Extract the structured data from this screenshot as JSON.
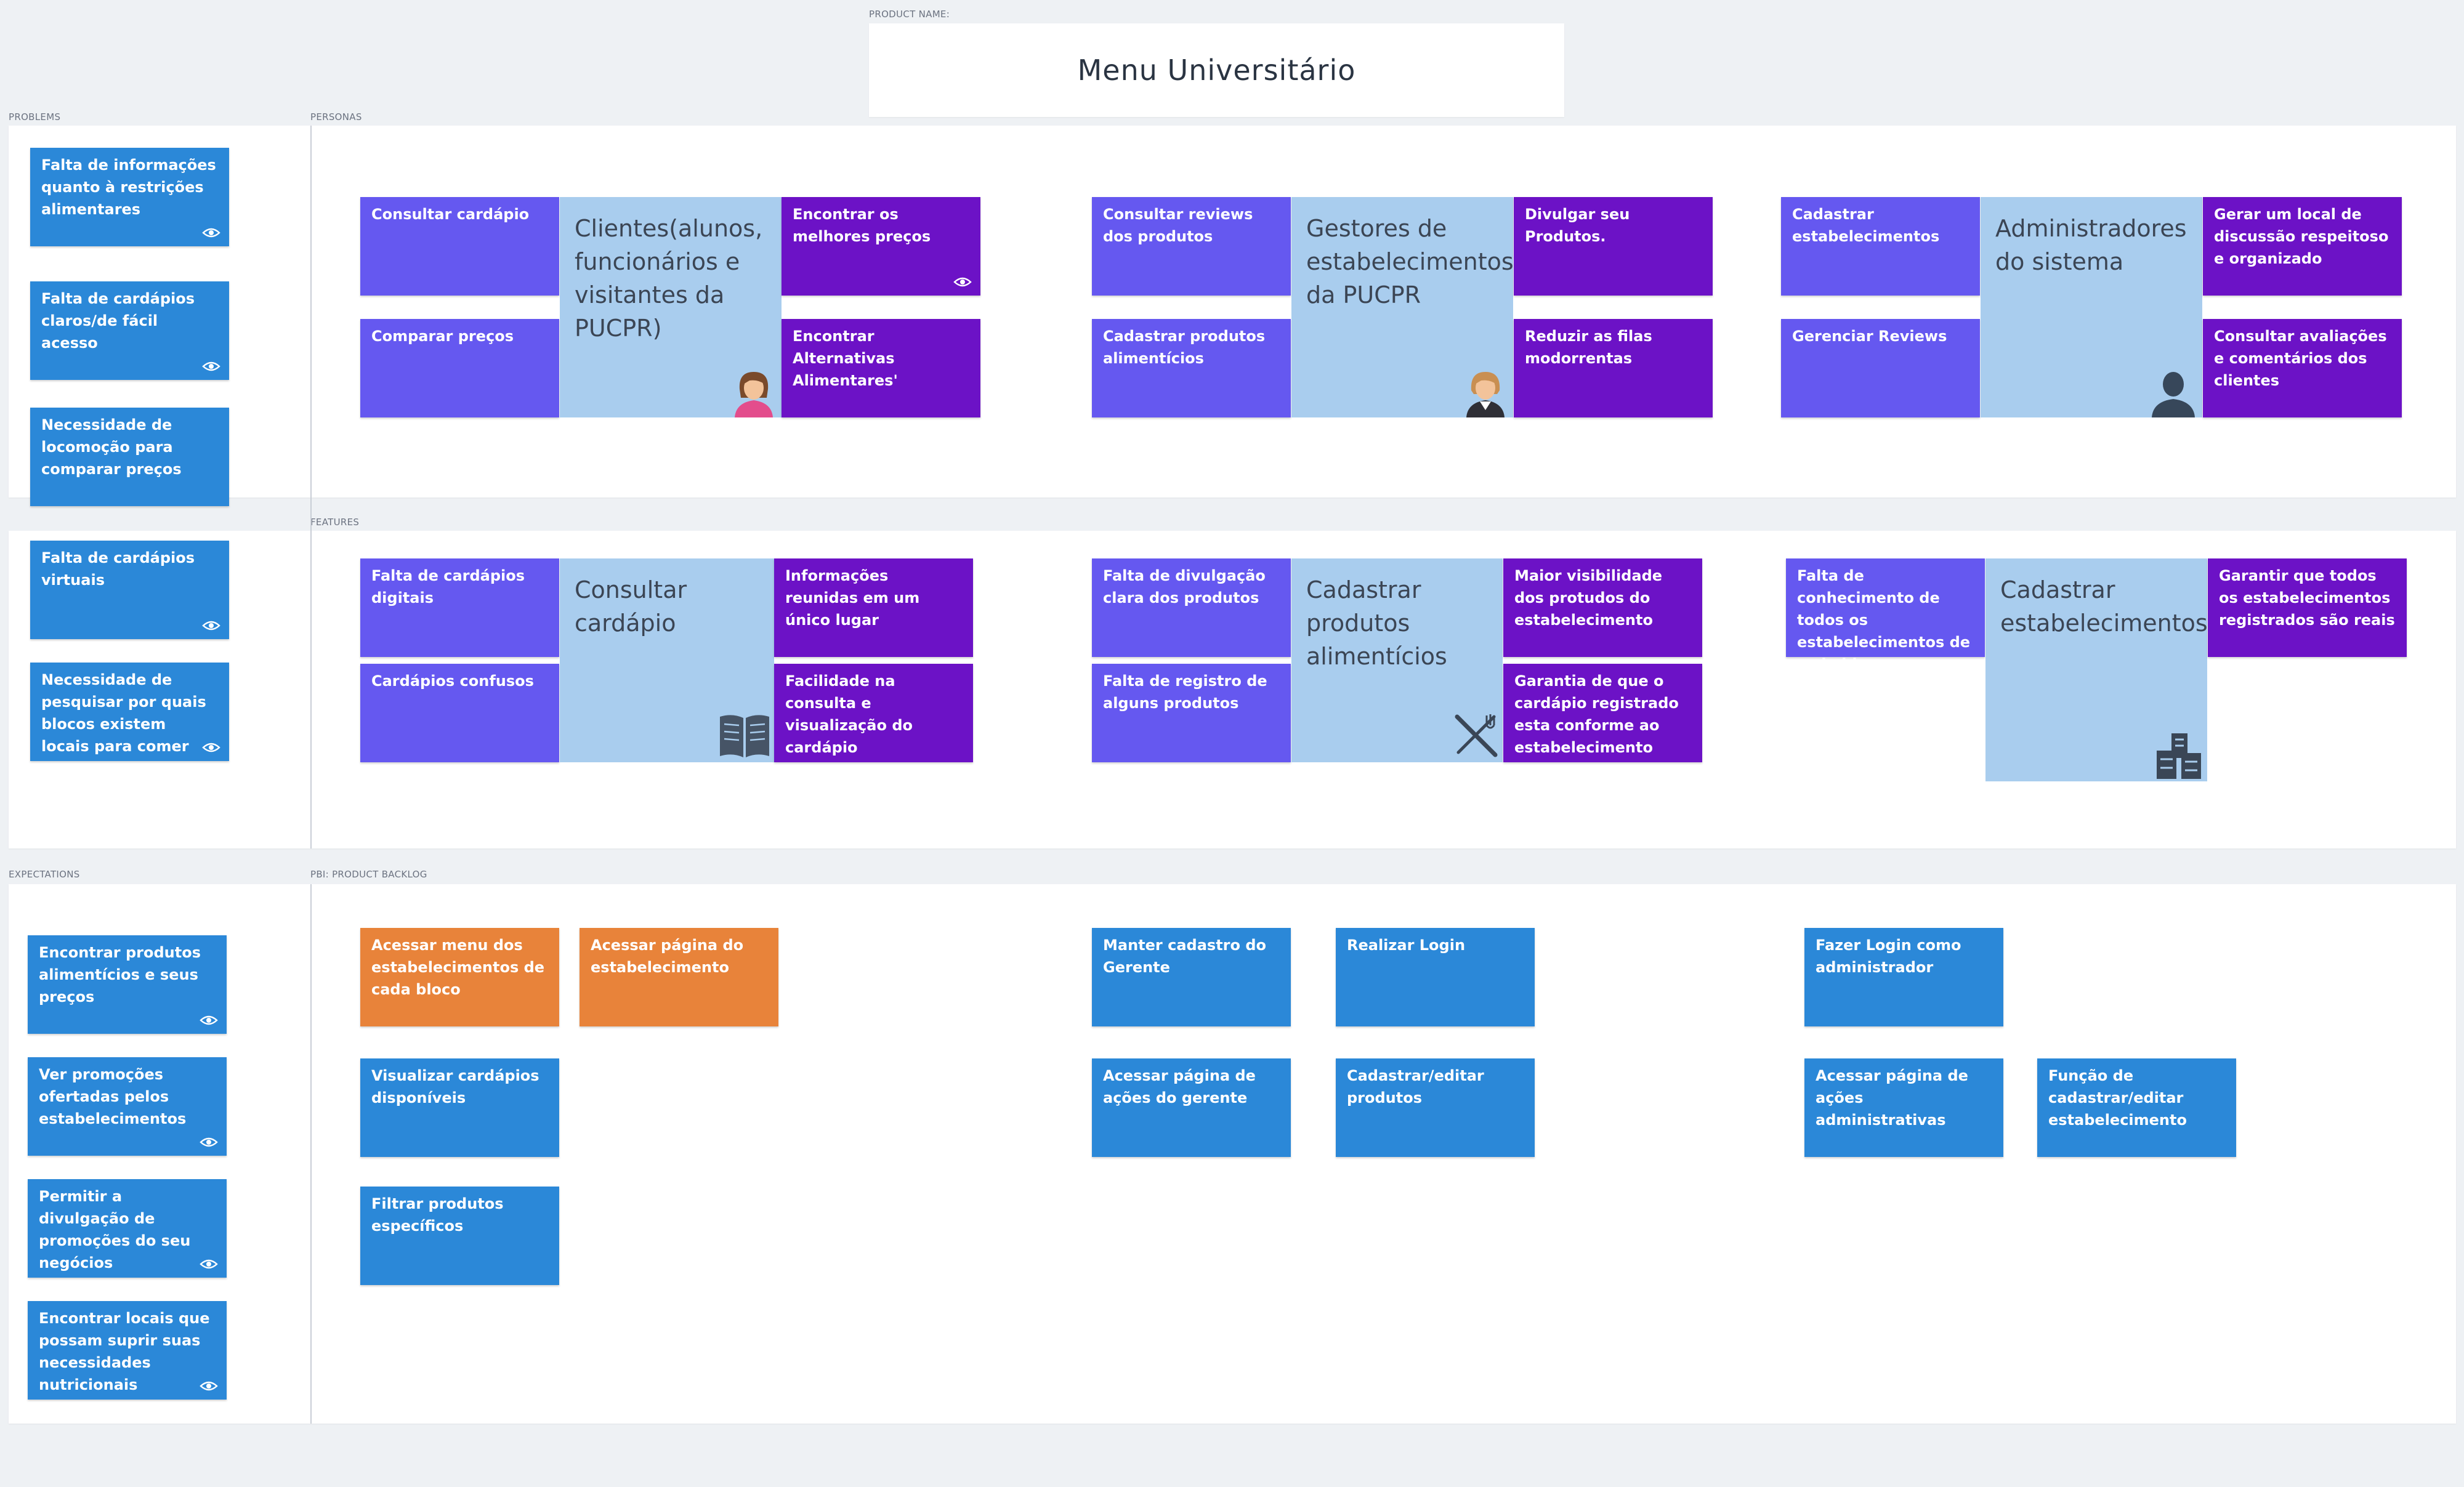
{
  "product": {
    "label": "PRODUCT NAME:",
    "name": "Menu Universitário"
  },
  "sections": {
    "problems": "PROBLEMS",
    "personas": "PERSONAS",
    "features": "FEATURES",
    "expectations": "EXPECTATIONS",
    "backlog": "PBI: PRODUCT BACKLOG"
  },
  "problems": [
    "Falta de informações quanto à restrições alimentares",
    "Falta de cardápios claros/de fácil acesso",
    "Necessidade de locomoção para comparar preços",
    "Falta de cardápios virtuais",
    "Necessidade de pesquisar por quais blocos existem locais para comer"
  ],
  "personas": [
    {
      "name": "Clientes(alunos, funcionários e visitantes da PUCPR)",
      "left": [
        "Consultar cardápio",
        "Comparar preços"
      ],
      "right": [
        "Encontrar os melhores preços",
        "Encontrar Alternativas Alimentares'"
      ],
      "icon": "woman-avatar-icon"
    },
    {
      "name": "Gestores de estabelecimentos da PUCPR",
      "left": [
        "Consultar reviews dos produtos",
        "Cadastrar produtos alimentícios"
      ],
      "right": [
        "Divulgar seu Produtos.",
        "Reduzir as filas modorrentas"
      ],
      "icon": "waitress-avatar-icon"
    },
    {
      "name": "Administradores do sistema",
      "left": [
        "Cadastrar estabelecimentos",
        "Gerenciar Reviews"
      ],
      "right": [
        "Gerar um local de discussão respeitoso e organizado",
        "Consultar avaliações e comentários dos clientes"
      ],
      "icon": "user-silhouette-icon"
    }
  ],
  "features": [
    {
      "name": "Consultar cardápio",
      "left": [
        "Falta de cardápios digitais",
        "Cardápios confusos"
      ],
      "right": [
        "Informações reunidas em um único lugar",
        "Facilidade na consulta e visualização do cardápio"
      ],
      "icon": "book-icon"
    },
    {
      "name": "Cadastrar produtos alimentícios",
      "left": [
        "Falta de divulgação clara dos produtos",
        "Falta de registro de alguns produtos"
      ],
      "right": [
        "Maior visibilidade dos protudos do estabelecimento",
        "Garantia de que o cardápio registrado esta conforme ao estabelecimento"
      ],
      "icon": "fork-knife-icon"
    },
    {
      "name": "Cadastrar estabelecimentos",
      "left": [
        "Falta de conhecimento de todos os estabelecimentos de cada bloco"
      ],
      "right": [
        "Garantir que todos os estabelecimentos registrados são reais"
      ],
      "icon": "buildings-icon"
    }
  ],
  "expectations": [
    "Encontrar produtos alimentícios e seus preços",
    "Ver promoções ofertadas pelos estabelecimentos",
    "Permitir a divulgação de promoções do seu negócios",
    "Encontrar locais que possam suprir suas necessidades nutricionais"
  ],
  "backlog": {
    "group1": [
      "Acessar menu dos estabelecimentos de cada bloco",
      "Acessar página do estabelecimento",
      "Visualizar cardápios disponíveis",
      "Filtrar produtos específicos"
    ],
    "group2": [
      "Manter cadastro do Gerente",
      "Realizar Login",
      "Acessar página de ações do gerente",
      "Cadastrar/editar produtos"
    ],
    "group3": [
      "Fazer Login como administrador",
      "Acessar página de ações administrativas",
      "Função de cadastrar/editar estabelecimento"
    ]
  },
  "colors": {
    "blue": "#2b88d8",
    "violet": "#6558f0",
    "purple": "#6c12c6",
    "orange": "#e8833a",
    "persona_fill": "#a9cdee"
  }
}
